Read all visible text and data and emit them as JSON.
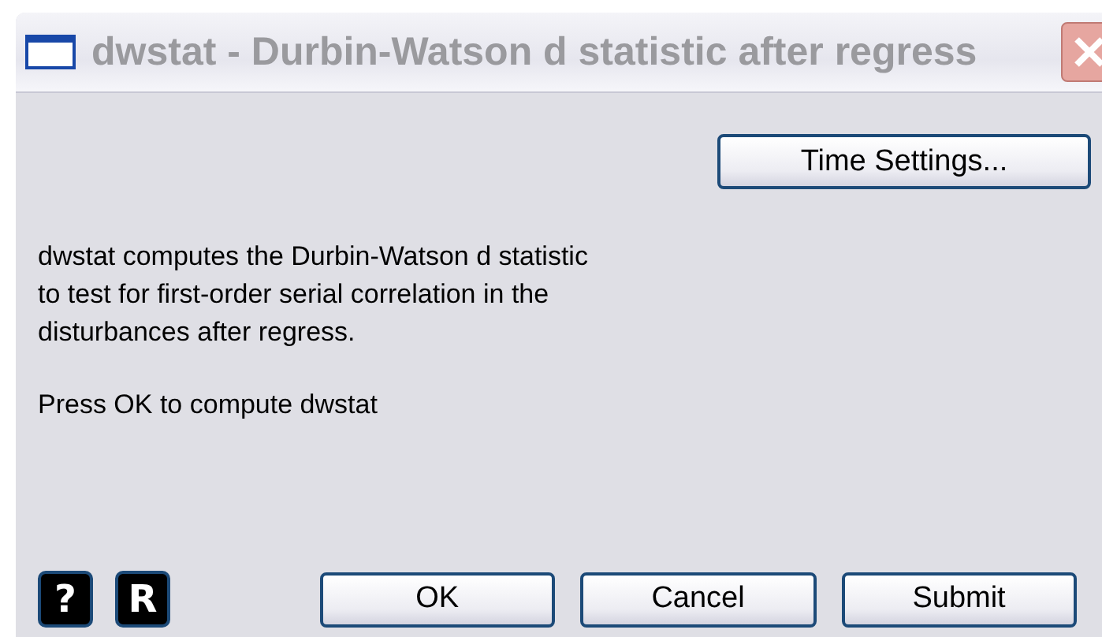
{
  "window": {
    "title": "dwstat - Durbin-Watson d statistic after regress",
    "active": false
  },
  "top_button": "Time Settings...",
  "description": [
    "dwstat computes the Durbin-Watson d statistic",
    "to test for first-order serial correlation in the",
    "disturbances after regress."
  ],
  "prompt": "Press OK to compute dwstat",
  "tool_buttons": [
    "?",
    "R"
  ],
  "buttons": [
    "OK",
    "Cancel",
    "Submit"
  ]
}
